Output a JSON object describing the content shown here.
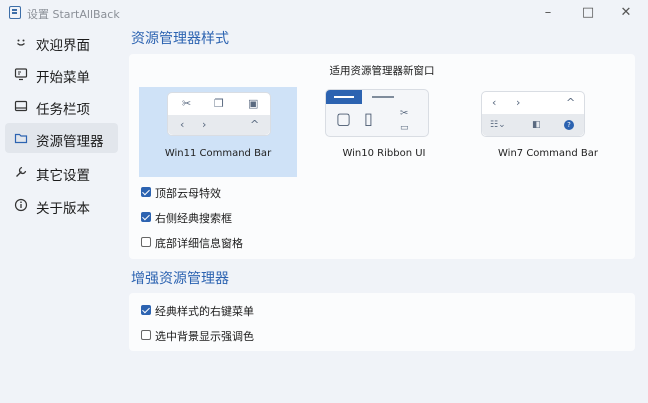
{
  "window": {
    "title": "设置 StartAllBack",
    "controls": {
      "minimize": "–",
      "maximize": "□",
      "close": "✕"
    }
  },
  "sidebar": {
    "items": [
      {
        "label": "欢迎界面",
        "icon": "smile-icon"
      },
      {
        "label": "开始菜单",
        "icon": "monitor-icon"
      },
      {
        "label": "任务栏项",
        "icon": "taskbar-icon"
      },
      {
        "label": "资源管理器",
        "icon": "folder-icon",
        "selected": true
      },
      {
        "label": "其它设置",
        "icon": "wrench-icon"
      },
      {
        "label": "关于版本",
        "icon": "info-icon"
      }
    ]
  },
  "explorer_style": {
    "title": "资源管理器样式",
    "apply_label": "适用资源管理器新窗口",
    "options": [
      {
        "label": "Win11 Command Bar",
        "selected": true
      },
      {
        "label": "Win10 Ribbon UI",
        "selected": false
      },
      {
        "label": "Win7 Command Bar",
        "selected": false
      }
    ],
    "checkboxes": [
      {
        "label": "顶部云母特效",
        "checked": true
      },
      {
        "label": "右侧经典搜索框",
        "checked": true
      },
      {
        "label": "底部详细信息窗格",
        "checked": false
      }
    ]
  },
  "enhance": {
    "title": "增强资源管理器",
    "checkboxes": [
      {
        "label": "经典样式的右键菜单",
        "checked": true
      },
      {
        "label": "选中背景显示强调色",
        "checked": false
      }
    ]
  },
  "colors": {
    "accent": "#2c63b1",
    "selected_option": "#cfe2f7",
    "selected_nav": "#e2e6ec"
  }
}
